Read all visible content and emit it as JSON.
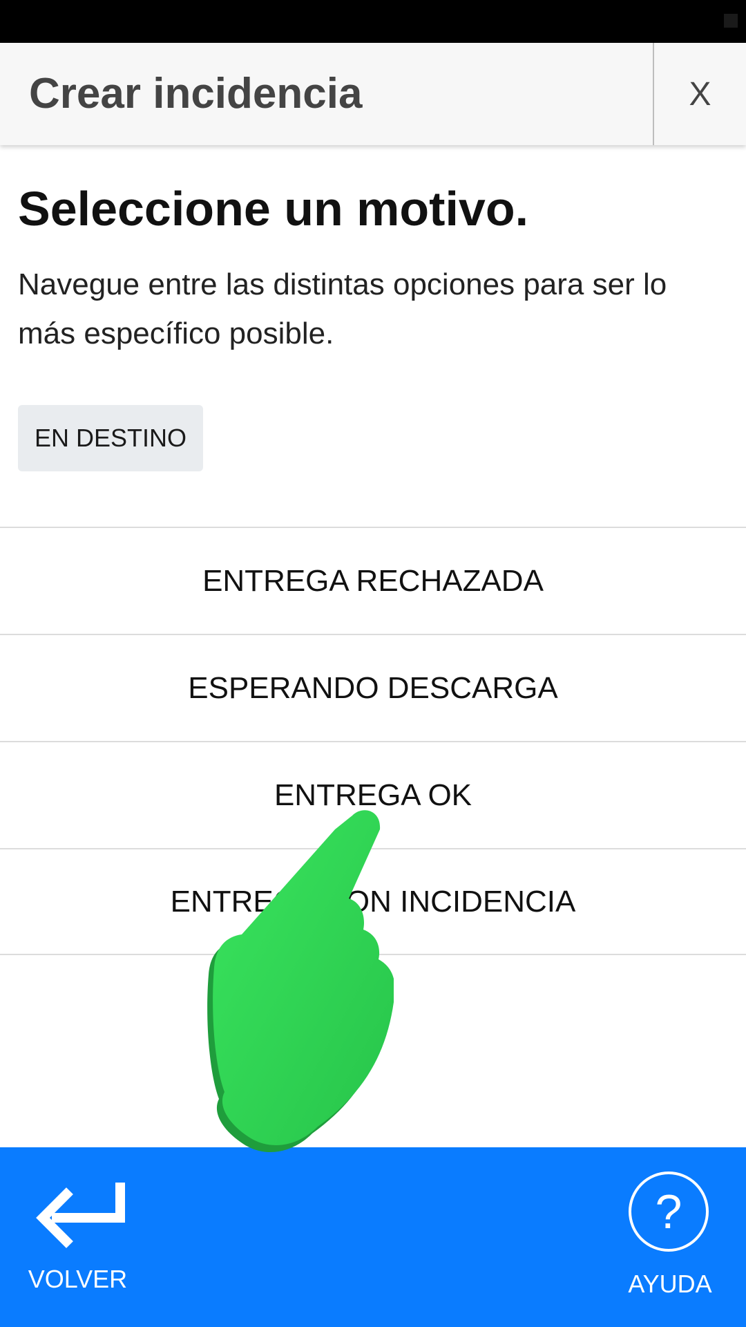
{
  "header": {
    "title": "Crear incidencia",
    "close_label": "X"
  },
  "content": {
    "title": "Seleccione un motivo.",
    "subtitle": "Navegue entre las distintas opciones para ser lo más específico posible.",
    "breadcrumb_chip": "EN DESTINO"
  },
  "options": [
    {
      "label": "ENTREGA RECHAZADA"
    },
    {
      "label": "ESPERANDO DESCARGA"
    },
    {
      "label": "ENTREGA OK"
    },
    {
      "label": "ENTREGA CON INCIDENCIA"
    }
  ],
  "bottom_bar": {
    "back_label": "VOLVER",
    "back_icon": "return-arrow-icon",
    "help_label": "AYUDA",
    "help_icon": "?"
  },
  "colors": {
    "bottom_bar": "#0a7cff",
    "header_bg": "#f7f7f7",
    "chip_bg": "#e9ecef",
    "hand_pointer": "#33dd55"
  }
}
